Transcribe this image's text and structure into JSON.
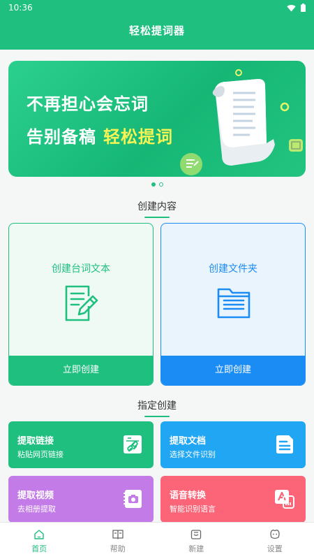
{
  "status_bar": {
    "time": "10:36"
  },
  "app": {
    "title": "轻松提词器"
  },
  "banner": {
    "line1": "不再担心会忘词",
    "line2_prefix": "告别备稿",
    "line2_highlight": "轻松提词"
  },
  "carousel": {
    "current": 1,
    "total": 2
  },
  "create_section": {
    "title": "创建内容",
    "cards": [
      {
        "title": "创建台词文本",
        "button": "立即创建",
        "icon": "edit-document-icon",
        "color": "#1fbf80"
      },
      {
        "title": "创建文件夹",
        "button": "立即创建",
        "icon": "folder-icon",
        "color": "#1c8cf5"
      }
    ]
  },
  "specified_section": {
    "title": "指定创建",
    "tiles": [
      {
        "title": "提取链接",
        "subtitle": "粘贴网页链接",
        "icon": "link-icon",
        "color": "#1fbf80"
      },
      {
        "title": "提取文档",
        "subtitle": "选择文件识别",
        "icon": "document-icon",
        "color": "#20a6f3"
      },
      {
        "title": "提取视频",
        "subtitle": "去相册提取",
        "icon": "camera-icon",
        "color": "#c37be8"
      },
      {
        "title": "语音转换",
        "subtitle": "智能识别语言",
        "icon": "translate-icon",
        "color": "#fb6577"
      }
    ]
  },
  "bottom_nav": [
    {
      "label": "首页",
      "icon": "home-icon",
      "active": true
    },
    {
      "label": "帮助",
      "icon": "book-icon",
      "active": false
    },
    {
      "label": "新建",
      "icon": "new-icon",
      "active": false
    },
    {
      "label": "设置",
      "icon": "settings-face-icon",
      "active": false
    }
  ],
  "colors": {
    "primary": "#1fbf80",
    "blue": "#1c8cf5",
    "purple": "#c37be8",
    "red": "#fb6577",
    "sky": "#20a6f3"
  }
}
